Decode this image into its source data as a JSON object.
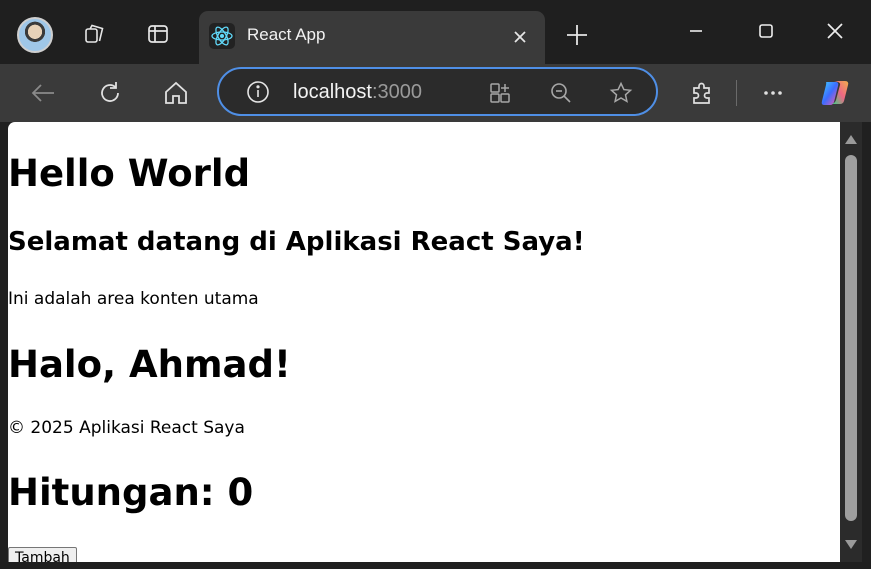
{
  "browser": {
    "tab": {
      "title": "React App",
      "favicon": "react-logo-icon"
    },
    "address": {
      "host": "localhost",
      "port": ":3000"
    },
    "icons": {
      "workspaces": "workspaces-icon",
      "tab_actions": "tab-actions-icon",
      "close_tab": "close-icon",
      "new_tab": "plus-icon",
      "minimize": "minimize-icon",
      "maximize": "maximize-icon",
      "close_window": "close-icon",
      "back": "back-arrow-icon",
      "refresh": "refresh-icon",
      "home": "home-icon",
      "site_info": "info-icon",
      "app_available": "app-available-icon",
      "zoom": "zoom-out-icon",
      "favorite": "star-icon",
      "extensions": "puzzle-icon",
      "more": "more-icon",
      "copilot": "copilot-icon"
    },
    "colors": {
      "focus_ring": "#4f8fe6",
      "react_blue": "#61dafb"
    }
  },
  "page": {
    "heading_hello": "Hello World",
    "welcome": "Selamat datang di Aplikasi React Saya!",
    "main_text": "Ini adalah area konten utama",
    "greeting": "Halo, Ahmad!",
    "footer": "© 2025 Aplikasi React Saya",
    "counter": "Hitungan: 0",
    "add_button": "Tambah"
  }
}
